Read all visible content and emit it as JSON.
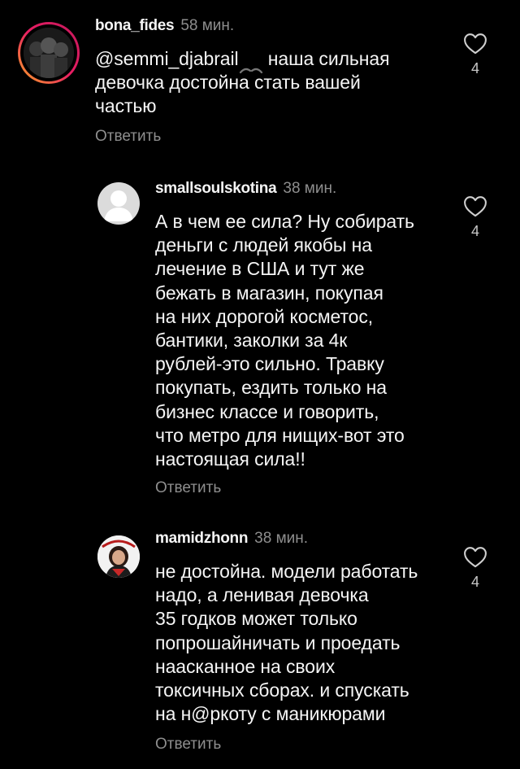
{
  "comments": [
    {
      "username": "bona_fides",
      "time": "58 мин.",
      "mention": "@semmi_djabrail",
      "text_after_mention": " наша сильная\nдевочка достойна стать вашей\nчастью",
      "reply_label": "Ответить",
      "likes": "4",
      "avatar_icon": "dark-group-photo"
    },
    {
      "username": "smallsoulskotina",
      "time": "38 мин.",
      "text": "А в чем ее сила? Ну собирать\nденьги с людей якобы на\nлечение в США и тут же\nбежать в магазин, покупая\nна них дорогой косметос,\nбантики, заколки за 4к\nрублей-это сильно. Травку\nпокупать, ездить только на\nбизнес классе и говорить,\nчто метро для нищих-вот это\nнастоящая сила!!",
      "reply_label": "Ответить",
      "likes": "4",
      "avatar_icon": "default-user"
    },
    {
      "username": "mamidzhonn",
      "time": "38 мин.",
      "text": "не достойна. модели работать\nнадо, а ленивая девочка\n35 годков может только\nпопрошайничать и проедать\nнаасканное на своих\nтоксичных сборах. и спускать\nна н@ркоту с маникюрами",
      "reply_label": "Ответить",
      "likes": "4",
      "avatar_icon": "woman-portrait"
    }
  ],
  "colors": {
    "background": "#000000",
    "text": "#f5f5f5",
    "secondary": "#8e8e8e",
    "story_ring_start": "#f9a825",
    "story_ring_end": "#c2185b"
  }
}
